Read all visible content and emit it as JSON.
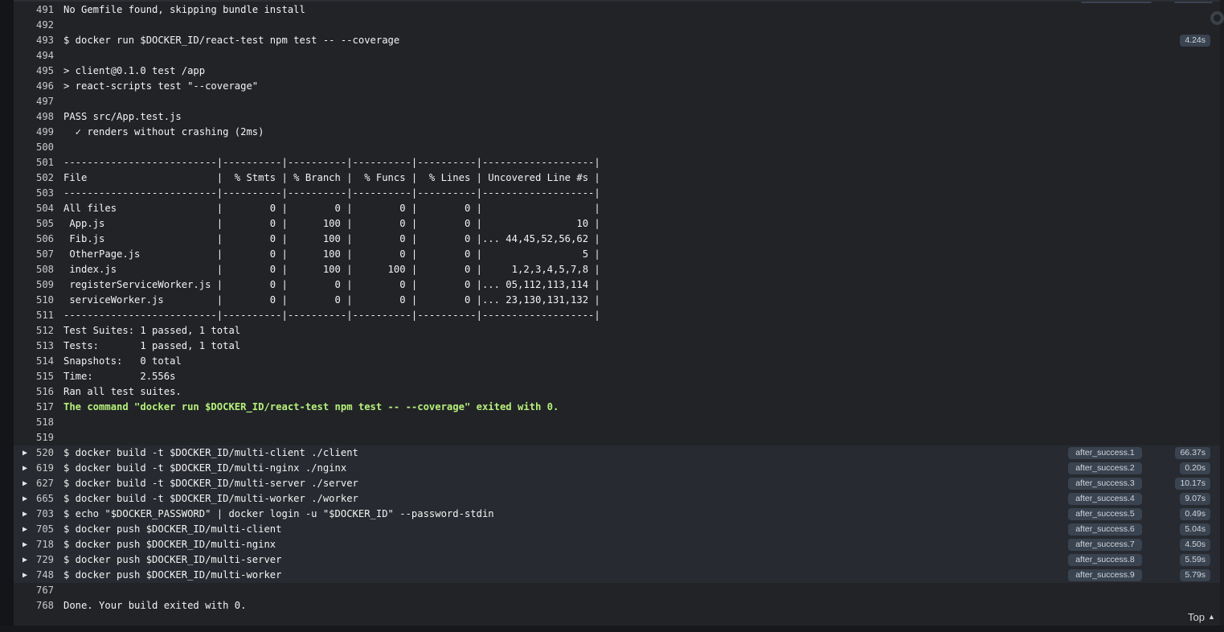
{
  "log": {
    "lines": [
      {
        "num": "491",
        "text": "No Gemfile found, skipping bundle install"
      },
      {
        "num": "492",
        "text": ""
      },
      {
        "num": "493",
        "text": "$ docker run $DOCKER_ID/react-test npm test -- --coverage",
        "time": "4.24s"
      },
      {
        "num": "494",
        "text": ""
      },
      {
        "num": "495",
        "text": "> client@0.1.0 test /app"
      },
      {
        "num": "496",
        "text": "> react-scripts test \"--coverage\""
      },
      {
        "num": "497",
        "text": ""
      },
      {
        "num": "498",
        "text": "PASS src/App.test.js"
      },
      {
        "num": "499",
        "text": "  ✓ renders without crashing (2ms)"
      },
      {
        "num": "500",
        "text": ""
      },
      {
        "num": "501",
        "text": "--------------------------|----------|----------|----------|----------|-------------------|"
      },
      {
        "num": "502",
        "text": "File                      |  % Stmts | % Branch |  % Funcs |  % Lines | Uncovered Line #s |"
      },
      {
        "num": "503",
        "text": "--------------------------|----------|----------|----------|----------|-------------------|"
      },
      {
        "num": "504",
        "text": "All files                 |        0 |        0 |        0 |        0 |                   |"
      },
      {
        "num": "505",
        "text": " App.js                   |        0 |      100 |        0 |        0 |                10 |"
      },
      {
        "num": "506",
        "text": " Fib.js                   |        0 |      100 |        0 |        0 |... 44,45,52,56,62 |"
      },
      {
        "num": "507",
        "text": " OtherPage.js             |        0 |      100 |        0 |        0 |                 5 |"
      },
      {
        "num": "508",
        "text": " index.js                 |        0 |      100 |      100 |        0 |     1,2,3,4,5,7,8 |"
      },
      {
        "num": "509",
        "text": " registerServiceWorker.js |        0 |        0 |        0 |        0 |... 05,112,113,114 |"
      },
      {
        "num": "510",
        "text": " serviceWorker.js         |        0 |        0 |        0 |        0 |... 23,130,131,132 |"
      },
      {
        "num": "511",
        "text": "--------------------------|----------|----------|----------|----------|-------------------|"
      },
      {
        "num": "512",
        "text": "Test Suites: 1 passed, 1 total"
      },
      {
        "num": "513",
        "text": "Tests:       1 passed, 1 total"
      },
      {
        "num": "514",
        "text": "Snapshots:   0 total"
      },
      {
        "num": "515",
        "text": "Time:        2.556s"
      },
      {
        "num": "516",
        "text": "Ran all test suites."
      },
      {
        "num": "517",
        "text": "The command \"docker run $DOCKER_ID/react-test npm test -- --coverage\" exited with 0.",
        "success": true
      },
      {
        "num": "518",
        "text": ""
      },
      {
        "num": "519",
        "text": ""
      },
      {
        "num": "520",
        "text": "$ docker build -t $DOCKER_ID/multi-client ./client",
        "fold": true,
        "stage": "after_success.1",
        "time": "66.37s"
      },
      {
        "num": "619",
        "text": "$ docker build -t $DOCKER_ID/multi-nginx ./nginx",
        "fold": true,
        "stage": "after_success.2",
        "time": "0.20s"
      },
      {
        "num": "627",
        "text": "$ docker build -t $DOCKER_ID/multi-server ./server",
        "fold": true,
        "stage": "after_success.3",
        "time": "10.17s"
      },
      {
        "num": "665",
        "text": "$ docker build -t $DOCKER_ID/multi-worker ./worker",
        "fold": true,
        "stage": "after_success.4",
        "time": "9.07s"
      },
      {
        "num": "703",
        "text": "$ echo \"$DOCKER_PASSWORD\" | docker login -u \"$DOCKER_ID\" --password-stdin",
        "fold": true,
        "stage": "after_success.5",
        "time": "0.49s"
      },
      {
        "num": "705",
        "text": "$ docker push $DOCKER_ID/multi-client",
        "fold": true,
        "stage": "after_success.6",
        "time": "5.04s"
      },
      {
        "num": "718",
        "text": "$ docker push $DOCKER_ID/multi-nginx",
        "fold": true,
        "stage": "after_success.7",
        "time": "4.50s"
      },
      {
        "num": "729",
        "text": "$ docker push $DOCKER_ID/multi-server",
        "fold": true,
        "stage": "after_success.8",
        "time": "5.59s"
      },
      {
        "num": "748",
        "text": "$ docker push $DOCKER_ID/multi-worker",
        "fold": true,
        "stage": "after_success.9",
        "time": "5.79s"
      },
      {
        "num": "767",
        "text": ""
      },
      {
        "num": "768",
        "text": "Done. Your build exited with 0."
      }
    ]
  },
  "fold_arrow_icon": "triangle-right-icon",
  "top_link": {
    "label": "Top",
    "icon": "triangle-up-icon"
  },
  "colors": {
    "background": "#212327",
    "success_text": "#b6f07a",
    "badge": "#3a4350"
  }
}
